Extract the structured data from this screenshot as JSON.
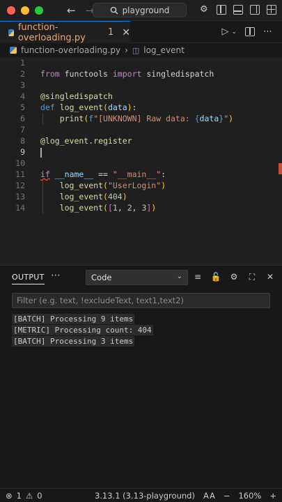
{
  "titlebar": {
    "search_text": "playground"
  },
  "tab": {
    "filename": "function-overloading.py",
    "problems_count": "1"
  },
  "breadcrumb": {
    "file": "function-overloading.py",
    "symbol": "log_event"
  },
  "editor": {
    "line_numbers": [
      "1",
      "2",
      "3",
      "4",
      "5",
      "6",
      "7",
      "8",
      "9",
      "10",
      "11",
      "12",
      "13",
      "14"
    ],
    "active_line": "9"
  },
  "panel": {
    "tab_label": "OUTPUT",
    "channel_selected": "Code",
    "filter_placeholder": "Filter (e.g. text, !excludeText, text1,text2)",
    "output_lines": [
      "[BATCH] Processing 9 items",
      "[METRIC] Processing count: 404",
      "[BATCH] Processing 3 items"
    ]
  },
  "status": {
    "errors": "1",
    "warnings": "0",
    "python_version": "3.13.1 (3.13-playground)",
    "zoom": "160%"
  },
  "colors": {
    "accent": "#0078d4",
    "editor_bg": "#1f1f1f",
    "panel_bg": "#181818",
    "error": "#f14c4c"
  }
}
